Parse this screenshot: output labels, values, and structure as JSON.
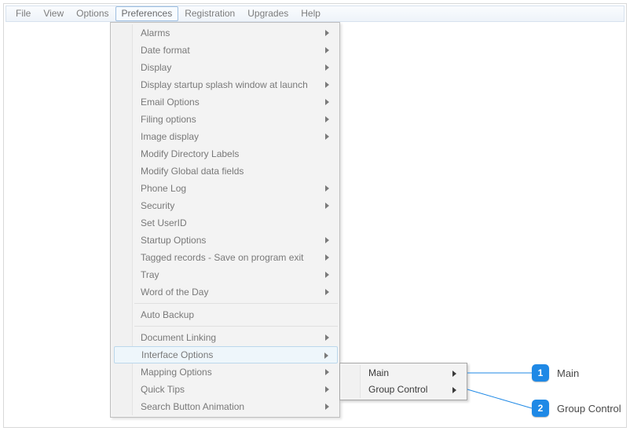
{
  "menubar": {
    "items": [
      "File",
      "View",
      "Options",
      "Preferences",
      "Registration",
      "Upgrades",
      "Help"
    ],
    "active_index": 3
  },
  "dropdown": {
    "groups": [
      [
        {
          "label": "Alarms",
          "submenu": true
        },
        {
          "label": "Date format",
          "submenu": true
        },
        {
          "label": "Display",
          "submenu": true
        },
        {
          "label": "Display startup splash window at launch",
          "submenu": true
        },
        {
          "label": "Email Options",
          "submenu": true
        },
        {
          "label": "Filing options",
          "submenu": true
        },
        {
          "label": "Image display",
          "submenu": true
        },
        {
          "label": "Modify Directory Labels",
          "submenu": false
        },
        {
          "label": "Modify Global data fields",
          "submenu": false
        },
        {
          "label": "Phone Log",
          "submenu": true
        },
        {
          "label": "Security",
          "submenu": true
        },
        {
          "label": "Set UserID",
          "submenu": false
        },
        {
          "label": "Startup Options",
          "submenu": true
        },
        {
          "label": "Tagged records - Save on program exit",
          "submenu": true
        },
        {
          "label": "Tray",
          "submenu": true
        },
        {
          "label": "Word of the Day",
          "submenu": true
        }
      ],
      [
        {
          "label": "Auto Backup",
          "submenu": false
        }
      ],
      [
        {
          "label": "Document Linking",
          "submenu": true
        },
        {
          "label": "Interface Options",
          "submenu": true,
          "highlight": true
        },
        {
          "label": "Mapping Options",
          "submenu": true
        },
        {
          "label": "Quick Tips",
          "submenu": true
        },
        {
          "label": "Search Button Animation",
          "submenu": true
        }
      ]
    ]
  },
  "submenu": {
    "items": [
      {
        "label": "Main",
        "submenu": true
      },
      {
        "label": "Group Control",
        "submenu": true
      }
    ]
  },
  "callouts": [
    {
      "num": "1",
      "label": "Main"
    },
    {
      "num": "2",
      "label": "Group Control"
    }
  ]
}
